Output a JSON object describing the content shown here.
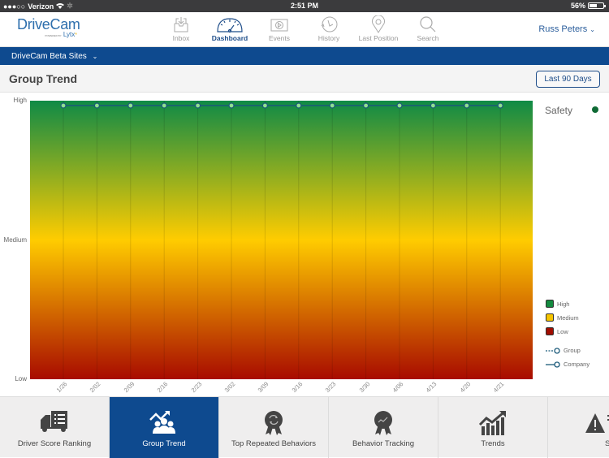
{
  "status_bar": {
    "carrier": "Verizon",
    "time": "2:51 PM",
    "battery": "56%",
    "battery_level": 0.56
  },
  "header": {
    "logo": {
      "name": "DriveCam",
      "powered_by": "POWERED BY",
      "brand": "Lytx"
    },
    "nav": [
      {
        "label": "Inbox",
        "icon": "inbox-icon",
        "active": false
      },
      {
        "label": "Dashboard",
        "icon": "dashboard-gauge-icon",
        "active": true
      },
      {
        "label": "Events",
        "icon": "events-play-icon",
        "active": false
      },
      {
        "label": "History",
        "icon": "history-clock-icon",
        "active": false
      },
      {
        "label": "Last Position",
        "icon": "map-pin-icon",
        "active": false
      },
      {
        "label": "Search",
        "icon": "search-icon",
        "active": false
      }
    ],
    "user": "Russ Peters"
  },
  "site_selector": {
    "label": "DriveCam Beta Sites"
  },
  "page": {
    "title": "Group Trend",
    "range_button": "Last 90 Days"
  },
  "chart_data": {
    "type": "line",
    "title": "Group Trend",
    "ylabel": "",
    "xlabel": "",
    "y_ticks": [
      "High",
      "Medium",
      "Low"
    ],
    "y_scale": [
      "Low",
      "Medium",
      "High"
    ],
    "x": [
      "1/26",
      "2/02",
      "2/09",
      "2/16",
      "2/23",
      "3/02",
      "3/09",
      "3/16",
      "3/23",
      "3/30",
      "4/06",
      "4/13",
      "4/20",
      "4/21"
    ],
    "series": [
      {
        "name": "Safety",
        "style": "Company",
        "values": [
          "High",
          "High",
          "High",
          "High",
          "High",
          "High",
          "High",
          "High",
          "High",
          "High",
          "High",
          "High",
          "High",
          "High"
        ]
      }
    ],
    "background_bands": [
      {
        "name": "High",
        "color": "#0f8a46"
      },
      {
        "name": "Medium",
        "color": "#ffcc00"
      },
      {
        "name": "Low",
        "color": "#a80b00"
      }
    ],
    "legend": {
      "series_title": "Safety",
      "series_color": "#0f6a35",
      "levels": [
        {
          "label": "High",
          "color": "#138a3f"
        },
        {
          "label": "Medium",
          "color": "#f5c400"
        },
        {
          "label": "Low",
          "color": "#a10d00"
        }
      ],
      "line_styles": [
        {
          "label": "Group",
          "style": "dashed"
        },
        {
          "label": "Company",
          "style": "solid"
        }
      ],
      "placement": "right"
    },
    "grid": true
  },
  "bottom_tabs": [
    {
      "label": "Driver Score Ranking",
      "icon": "truck-list-icon",
      "active": false
    },
    {
      "label": "Group Trend",
      "icon": "group-trend-icon",
      "active": true
    },
    {
      "label": "Top Repeated Behaviors",
      "icon": "award-repeat-icon",
      "active": false
    },
    {
      "label": "Behavior Tracking",
      "icon": "award-trend-icon",
      "active": false
    },
    {
      "label": "Trends",
      "icon": "bar-trend-icon",
      "active": false
    },
    {
      "label": "Safety Dashboard",
      "icon": "warning-icon",
      "active": false
    }
  ],
  "colors": {
    "brand_blue": "#0e4a8f",
    "nav_active": "#1f4e8a",
    "line_color": "#1b5a7a",
    "point_fill": "#8fe08f"
  }
}
